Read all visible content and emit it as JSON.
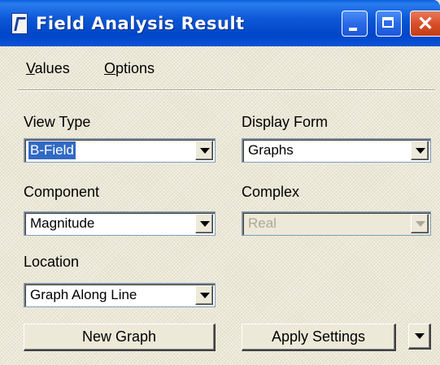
{
  "window": {
    "title": "Field Analysis Result",
    "icon": "field-analysis-app-icon",
    "controls": {
      "minimize_icon": "minimize-icon",
      "maximize_icon": "maximize-icon",
      "close_icon": "close-icon",
      "close_glyph": "✕"
    }
  },
  "menu": {
    "values_first": "V",
    "values_rest": "alues",
    "options_first": "O",
    "options_rest": "ptions"
  },
  "form": {
    "view_type": {
      "label": "View Type",
      "value": "B-Field",
      "selected": true
    },
    "display_form": {
      "label": "Display Form",
      "value": "Graphs"
    },
    "component": {
      "label": "Component",
      "value": "Magnitude"
    },
    "complex": {
      "label": "Complex",
      "value": "Real",
      "disabled": true
    },
    "location": {
      "label": "Location",
      "value": "Graph Along Line"
    }
  },
  "buttons": {
    "new_graph": "New Graph",
    "apply_settings": "Apply Settings",
    "more_icon": "dropdown-arrow-icon"
  },
  "colors": {
    "titlebar": "#0a52d6",
    "face": "#ece9d8",
    "selection": "#316ac5",
    "close_button": "#d8502a"
  }
}
